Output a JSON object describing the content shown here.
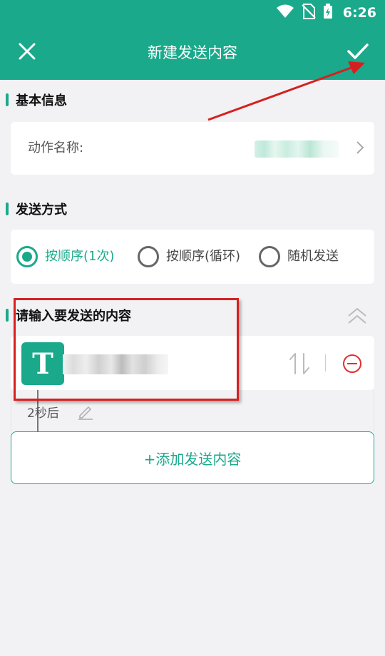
{
  "status_bar": {
    "time": "6:26",
    "icons": [
      "wifi-icon",
      "no-sim-icon",
      "battery-charging-icon"
    ]
  },
  "app_bar": {
    "title": "新建发送内容",
    "left_icon": "close-icon",
    "right_icon": "check-icon"
  },
  "basic_info": {
    "section_title": "基本信息",
    "action_name_label": "动作名称:"
  },
  "send_mode": {
    "section_title": "发送方式",
    "options": [
      {
        "label": "按顺序(1次)",
        "selected": true
      },
      {
        "label": "按顺序(循环)",
        "selected": false
      },
      {
        "label": "随机发送",
        "selected": false
      }
    ]
  },
  "content_section": {
    "section_title": "请输入要发送的内容",
    "items": [
      {
        "type_badge": "T",
        "delay_text": "2秒后"
      }
    ],
    "add_button_label": "+添加发送内容"
  },
  "colors": {
    "accent": "#1aa98b",
    "annotation": "#d62020",
    "remove": "#e03030"
  }
}
